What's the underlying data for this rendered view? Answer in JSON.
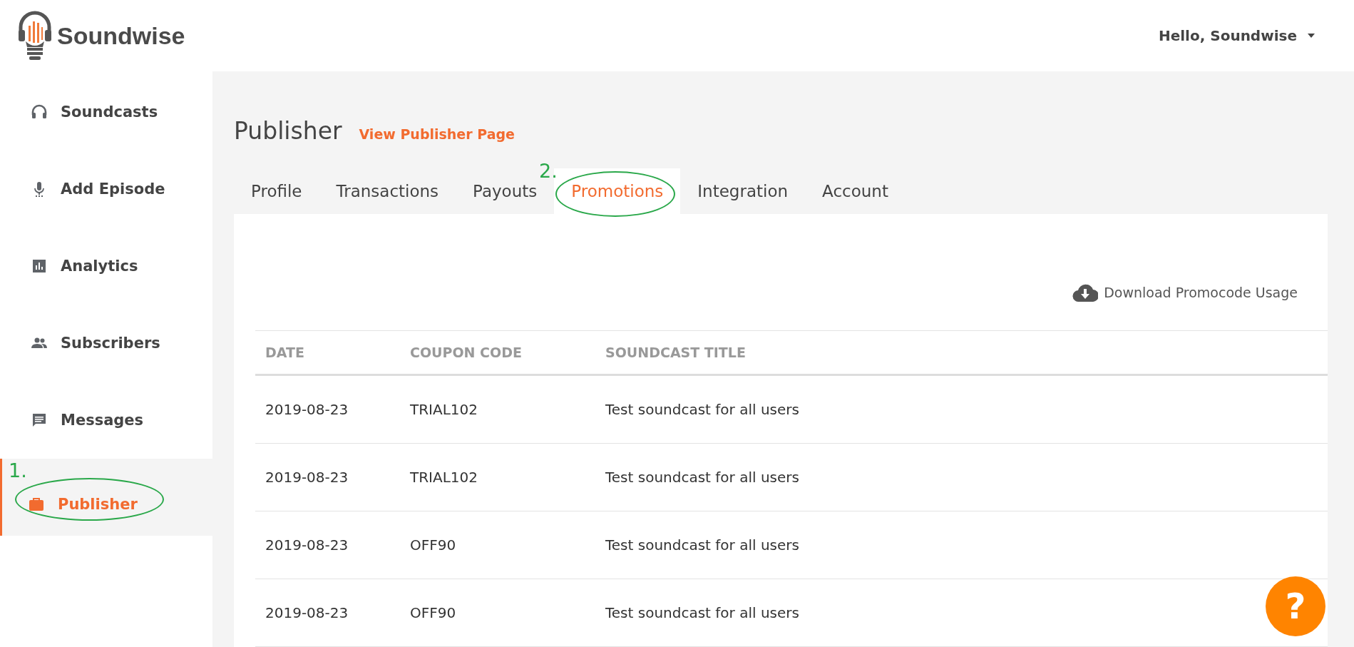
{
  "header": {
    "logo_text": "Soundwise",
    "greeting": "Hello, Soundwise"
  },
  "sidebar": {
    "items": [
      {
        "label": "Soundcasts",
        "kind": "headphones",
        "selected": false
      },
      {
        "label": "Add Episode",
        "kind": "microphone",
        "selected": false
      },
      {
        "label": "Analytics",
        "kind": "chart",
        "selected": false
      },
      {
        "label": "Subscribers",
        "kind": "people",
        "selected": false
      },
      {
        "label": "Messages",
        "kind": "message",
        "selected": false
      },
      {
        "label": "Publisher",
        "kind": "briefcase",
        "selected": true
      }
    ]
  },
  "page": {
    "title": "Publisher",
    "link": "View Publisher Page"
  },
  "tabs": [
    {
      "label": "Profile",
      "selected": false
    },
    {
      "label": "Transactions",
      "selected": false
    },
    {
      "label": "Payouts",
      "selected": false
    },
    {
      "label": "Promotions",
      "selected": true
    },
    {
      "label": "Integration",
      "selected": false
    },
    {
      "label": "Account",
      "selected": false
    }
  ],
  "download": "Download Promocode Usage",
  "table": {
    "columns": [
      "DATE",
      "COUPON CODE",
      "SOUNDCAST TITLE"
    ],
    "rows": [
      [
        "2019-08-23",
        "TRIAL102",
        "Test soundcast for all users"
      ],
      [
        "2019-08-23",
        "TRIAL102",
        "Test soundcast for all users"
      ],
      [
        "2019-08-23",
        "OFF90",
        "Test soundcast for all users"
      ],
      [
        "2019-08-23",
        "OFF90",
        "Test soundcast for all users"
      ]
    ]
  },
  "help": "?",
  "annotations": [
    {
      "label": "1.",
      "kind": "sidebar"
    },
    {
      "label": "2.",
      "kind": "tab"
    }
  ]
}
